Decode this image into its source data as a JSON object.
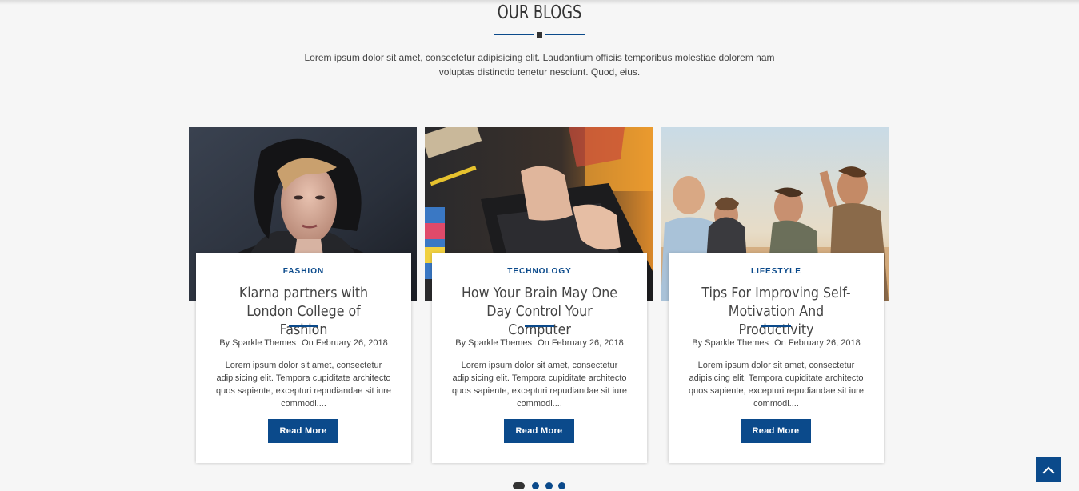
{
  "section": {
    "title": "OUR BLOGS",
    "intro": "Lorem ipsum dolor sit amet, consectetur adipisicing elit. Laudantium officiis temporibus molestiae dolorem nam voluptas distinctio tenetur nesciunt. Quod, eius."
  },
  "posts": [
    {
      "category": "FASHION",
      "title": "Klarna partners with London College of Fashion",
      "author": "By Sparkle Themes",
      "date": "On February 26, 2018",
      "excerpt": "Lorem ipsum dolor sit amet, consectetur adipisicing elit. Tempora cupiditate architecto quos sapiente, excepturi repudiandae sit iure commodi....",
      "button": "Read More",
      "image": "woman-in-fur-hood-photo"
    },
    {
      "category": "TECHNOLOGY",
      "title": "How Your Brain May One Day Control Your Computer",
      "author": "By Sparkle Themes",
      "date": "On February 26, 2018",
      "excerpt": "Lorem ipsum dolor sit amet, consectetur adipisicing elit. Tempora cupiditate architecto quos sapiente, excepturi repudiandae sit iure commodi....",
      "button": "Read More",
      "image": "hands-on-laptop-photo"
    },
    {
      "category": "LIFESTYLE",
      "title": "Tips For Improving Self-Motivation And Productivity",
      "author": "By Sparkle Themes",
      "date": "On February 26, 2018",
      "excerpt": "Lorem ipsum dolor sit amet, consectetur adipisicing elit. Tempora cupiditate architecto quos sapiente, excepturi repudiandae sit iure commodi....",
      "button": "Read More",
      "image": "friends-group-photo"
    }
  ],
  "carousel": {
    "pages": 4,
    "active": 1
  },
  "scroll_top_icon": "chevron-up-icon",
  "colors": {
    "accent": "#0b4a8b",
    "background": "#f6f6f6",
    "text": "#444444"
  }
}
